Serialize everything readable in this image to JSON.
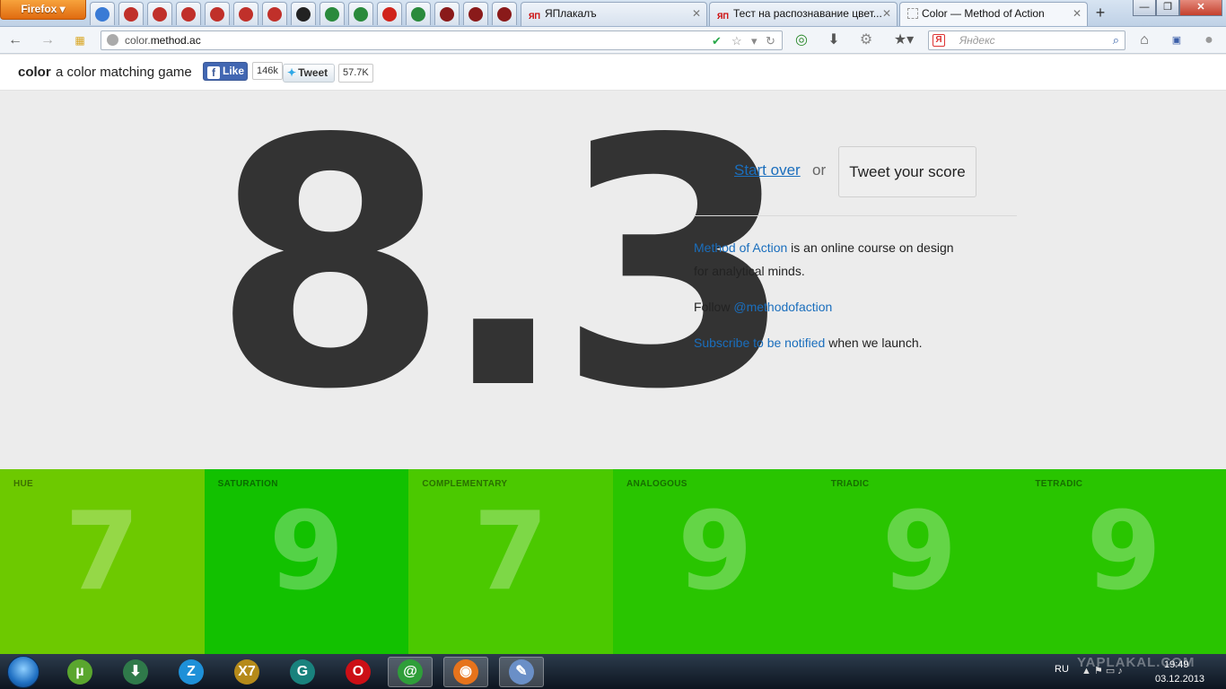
{
  "browser": {
    "menu_button": "Firefox",
    "pinned_tabs": [
      {
        "icon": "mail-at-icon",
        "color": "#3a7bd5"
      },
      {
        "icon": "yaplakal-ie-icon",
        "color": "#c0302a"
      },
      {
        "icon": "yaplakal-ie-icon",
        "color": "#c0302a"
      },
      {
        "icon": "yaplakal-ie-icon",
        "color": "#c0302a"
      },
      {
        "icon": "yaplakal-ie-icon",
        "color": "#c0302a"
      },
      {
        "icon": "yaplakal-ie-icon",
        "color": "#c0302a"
      },
      {
        "icon": "yaplakal-ie-icon",
        "color": "#c0302a"
      },
      {
        "icon": "gear-icon",
        "color": "#222222"
      },
      {
        "icon": "colored-dots-icon",
        "color": "#2a8a3c"
      },
      {
        "icon": "colored-dots-icon",
        "color": "#2a8a3c"
      },
      {
        "icon": "red-circle-icon",
        "color": "#d0241c"
      },
      {
        "icon": "colored-dots-icon",
        "color": "#2a8a3c"
      },
      {
        "icon": "car-icon",
        "color": "#8a1a1a"
      },
      {
        "icon": "car-icon",
        "color": "#8a1a1a"
      },
      {
        "icon": "car-icon",
        "color": "#8a1a1a"
      }
    ],
    "tabs": [
      {
        "label": "ЯПлакалъ",
        "favicon": "ЯП",
        "active": false
      },
      {
        "label": "Тест на распознавание цвет...",
        "favicon": "ЯП",
        "active": false
      },
      {
        "label": "Color — Method of Action",
        "favicon": "",
        "active": true
      }
    ],
    "new_tab": "+",
    "url_prefix": "color.",
    "url_domain": "method.ac",
    "search_placeholder": "Яндекс",
    "window_controls": {
      "minimize": "—",
      "maximize": "❐",
      "close": "✕"
    }
  },
  "site": {
    "brand": "color",
    "tagline": "a color matching game",
    "fb_like": "Like",
    "fb_count": "146k",
    "tweet": "Tweet",
    "tweet_count": "57.7K"
  },
  "score": {
    "value": "8.3",
    "start_over": "Start over",
    "or": "or",
    "tweet_score": "Tweet your score"
  },
  "info": {
    "p1_link": "Method of Action",
    "p1_rest_a": " is an online course on design",
    "p1_rest_b": "for analytical minds.",
    "p2_prefix": "Follow ",
    "p2_link": "@methodofaction",
    "p3_link": "Subscribe to be notified",
    "p3_rest": " when we launch."
  },
  "categories": [
    {
      "label": "HUE",
      "score": "7",
      "color": "#6dc900"
    },
    {
      "label": "SATURATION",
      "score": "9",
      "color": "#12c100"
    },
    {
      "label": "COMPLEMENTARY",
      "score": "7",
      "color": "#4bc900"
    },
    {
      "label": "ANALOGOUS",
      "score": "9",
      "color": "#29c500"
    },
    {
      "label": "TRIADIC",
      "score": "9",
      "color": "#29c500"
    },
    {
      "label": "TETRADIC",
      "score": "9",
      "color": "#29c500"
    }
  ],
  "taskbar": {
    "apps": [
      {
        "icon": "utorrent-icon",
        "glyph": "µ",
        "color": "#5aa62e",
        "active": false
      },
      {
        "icon": "download-master-icon",
        "glyph": "⬇",
        "color": "#2f7a4a",
        "active": false
      },
      {
        "icon": "zona-icon",
        "glyph": "Z",
        "color": "#1e90d8",
        "active": false
      },
      {
        "icon": "x7-icon",
        "glyph": "X7",
        "color": "#b58a1a",
        "active": false
      },
      {
        "icon": "g-app-icon",
        "glyph": "G",
        "color": "#19827d",
        "active": false
      },
      {
        "icon": "opera-icon",
        "glyph": "O",
        "color": "#cc0f16",
        "active": false
      },
      {
        "icon": "mail-agent-icon",
        "glyph": "@",
        "color": "#2f9e3a",
        "active": true
      },
      {
        "icon": "firefox-icon",
        "glyph": "◉",
        "color": "#e6731c",
        "active": true
      },
      {
        "icon": "paint-icon",
        "glyph": "✎",
        "color": "#6a8fc7",
        "active": true
      }
    ],
    "lang": "RU",
    "time": "19:49",
    "date": "03.12.2013"
  },
  "watermark": "YAPLAKAL.COM"
}
